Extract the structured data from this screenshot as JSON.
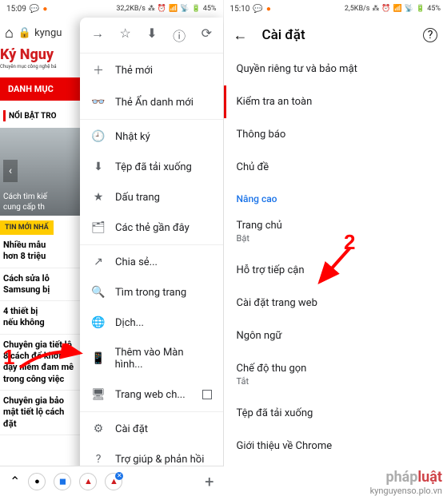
{
  "left": {
    "status": {
      "time": "15:09",
      "net": "32,2KB/s",
      "battery": "45%"
    },
    "url_text": "kyngu",
    "logo": "Kỷ Nguy",
    "logo_sub": "Chuyên mục công nghệ bá",
    "danhmuc": "DANH MỤC",
    "noibat": "NỔI BẬT TRO",
    "hero_caption": "Cách tìm kiế\ncung cấp th",
    "tinmoi": "TIN MỚI NHẤ",
    "articles": [
      "Nhiều mẫu ",
      "hơn 8 triệu",
      "Cách sửa lỗ",
      "Samsung bị",
      "4 thiết bị ",
      "nếu không ",
      "Chuyên gia tiết lộ 8 cách để khơi dậy niềm đam mê trong công việc",
      "Chuyên gia bảo mật tiết lộ cách đặt"
    ],
    "menu_top_icons": [
      "→",
      "☆",
      "⬇",
      "ⓘ",
      "⟳"
    ],
    "menu": [
      {
        "icon": "＋",
        "label": "Thẻ mới"
      },
      {
        "icon": "👓",
        "label": "Thẻ Ẩn danh mới"
      },
      {
        "icon": "🕘",
        "label": "Nhật ký"
      },
      {
        "icon": "⬇",
        "label": "Tệp đã tải xuống"
      },
      {
        "icon": "★",
        "label": "Dấu trang"
      },
      {
        "icon": "🗂",
        "label": "Các thẻ gần đây"
      },
      {
        "icon": "分享",
        "label": "Chia sẻ..."
      },
      {
        "icon": "🔍",
        "label": "Tìm trong trang"
      },
      {
        "icon": "🌐",
        "label": "Dịch..."
      },
      {
        "icon": "📱",
        "label": "Thêm vào Màn hình..."
      },
      {
        "icon": "🖥",
        "label": "Trang web ch...",
        "checkbox": true
      },
      {
        "icon": "⚙",
        "label": "Cài đặt"
      },
      {
        "icon": "?",
        "label": "Trợ giúp & phản hồi"
      }
    ]
  },
  "right": {
    "status": {
      "time": "15:10",
      "net": "2,5KB/s",
      "battery": "45%"
    },
    "title": "Cài đặt",
    "rows": [
      {
        "label": "Quyền riêng tư và bảo mật"
      },
      {
        "label": "Kiểm tra an toàn",
        "hl": true
      },
      {
        "label": "Thông báo"
      },
      {
        "label": "Chủ đề"
      }
    ],
    "section": "Nâng cao",
    "rows2": [
      {
        "label": "Trang chủ",
        "sub": "Bật"
      },
      {
        "label": "Hỗ trợ tiếp cận"
      },
      {
        "label": "Cài đặt trang web"
      },
      {
        "label": "Ngôn ngữ"
      },
      {
        "label": "Chế độ thu gọn",
        "sub": "Tắt"
      },
      {
        "label": "Tệp đã tải xuống"
      },
      {
        "label": "Giới thiệu về Chrome"
      }
    ]
  },
  "annotations": {
    "one": "1",
    "two": "2"
  },
  "watermark": {
    "brand_a": "pháp",
    "brand_b": "luật",
    "url": "kynguyenso.plo.vn"
  }
}
